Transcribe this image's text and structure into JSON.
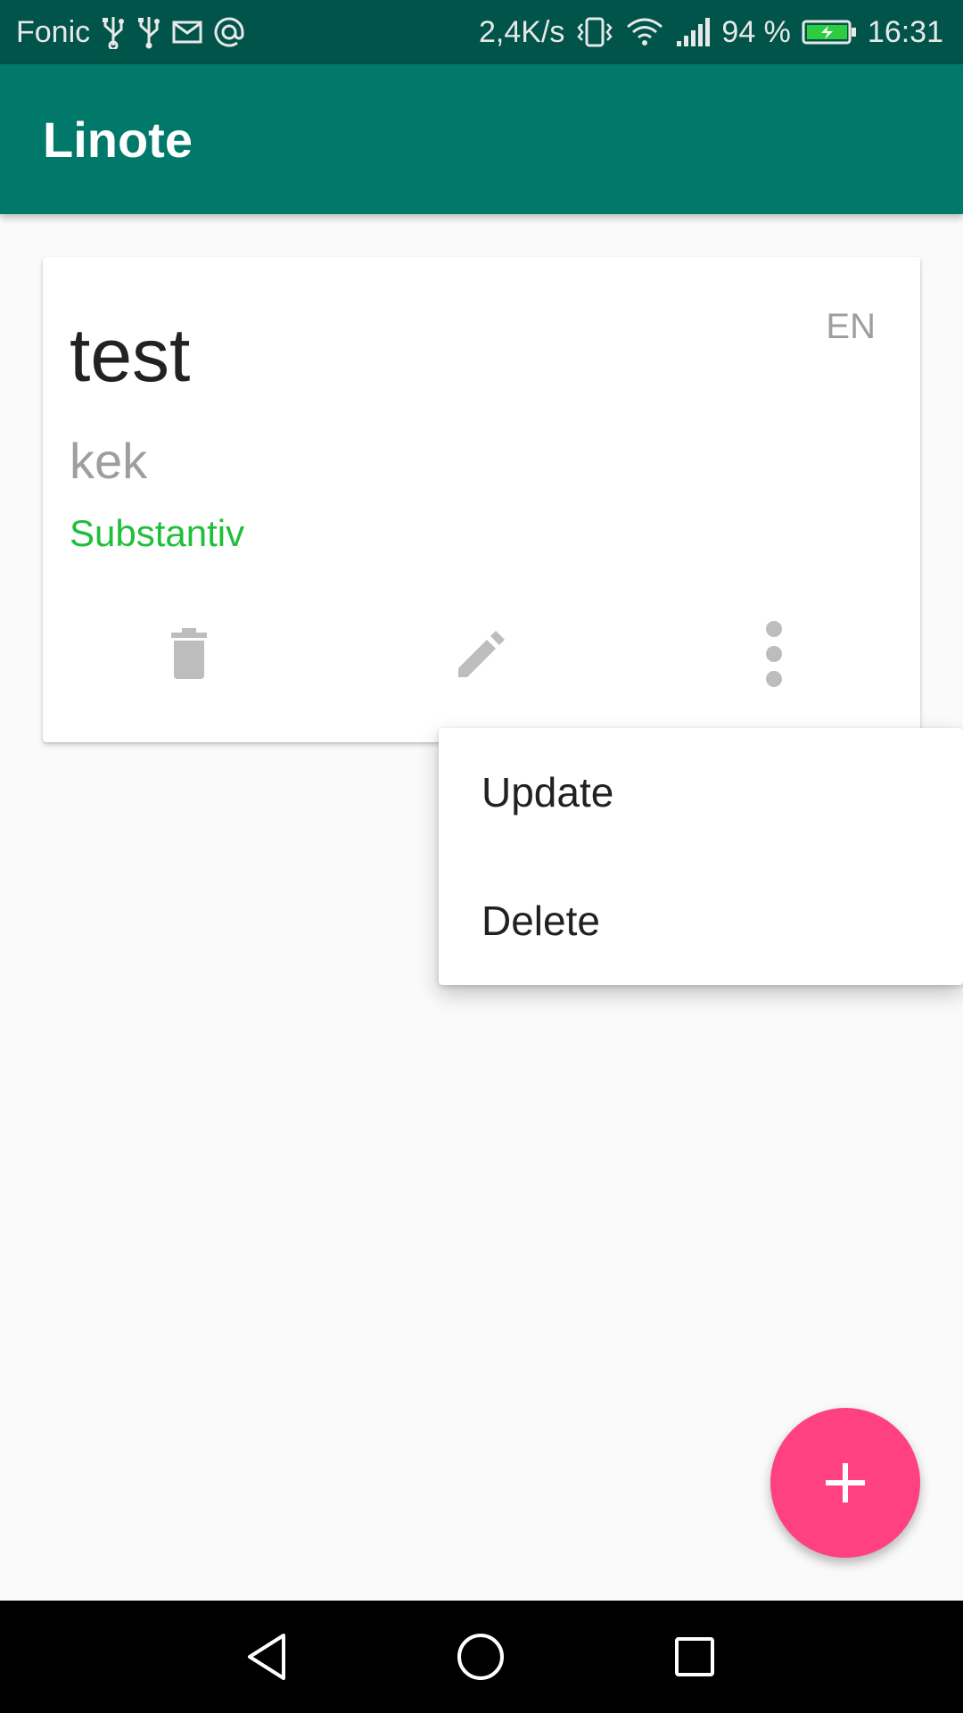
{
  "status_bar": {
    "carrier": "Fonic",
    "net_speed": "2,4K/s",
    "battery_percent": "94 %",
    "time": "16:31",
    "icons": [
      "usb-icon",
      "usb-icon",
      "mail-icon",
      "at-icon",
      "vibrate-icon",
      "wifi-icon",
      "signal-icon",
      "battery-charging-icon"
    ]
  },
  "app_bar": {
    "title": "Linote"
  },
  "card": {
    "word": "test",
    "language": "EN",
    "translation": "kek",
    "word_type": "Substantiv",
    "actions": [
      "delete-icon",
      "edit-icon",
      "more-vert-icon"
    ]
  },
  "popup_menu": {
    "items": [
      "Update",
      "Delete"
    ]
  },
  "fab": {
    "icon": "add-icon"
  },
  "nav_bar": {
    "buttons": [
      "back",
      "home",
      "recents"
    ]
  },
  "colors": {
    "status_bar": "#00544a",
    "app_bar": "#00786a",
    "word_type": "#1fbf3a",
    "fab": "#ff4081"
  }
}
